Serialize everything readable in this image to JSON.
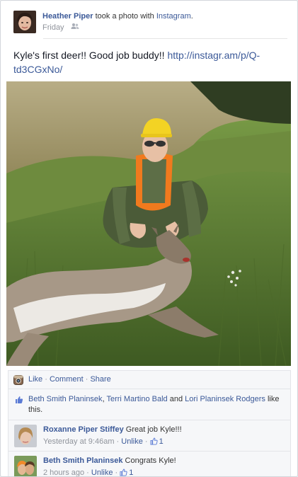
{
  "post": {
    "author": "Heather Piper",
    "action_prefix": "took a photo with",
    "app": "Instagram",
    "action_suffix": ".",
    "time": "Friday",
    "caption_text": "Kyle's first deer!! Good job buddy!!",
    "caption_url": "http://instagr.am/p/Q-td3CGxNo/"
  },
  "actions": {
    "like": "Like",
    "sep1": " · ",
    "comment": "Comment",
    "sep2": " · ",
    "share": "Share"
  },
  "likes": {
    "name1": "Beth Smith Planinsek",
    "sep1": ", ",
    "name2": "Terri Martino Bald",
    "sep2": " and ",
    "name3": "Lori Planinsek Rodgers",
    "suffix": " like this."
  },
  "comments": [
    {
      "author": "Roxanne Piper Stiffey",
      "text": "Great job Kyle!!!",
      "time": "Yesterday at 9:46am",
      "sep1": " · ",
      "unlike": "Unlike",
      "sep2": " · ",
      "likes": "1"
    },
    {
      "author": "Beth Smith Planinsek",
      "text": "Congrats Kyle!",
      "time": "2 hours ago",
      "sep1": " · ",
      "unlike": "Unlike",
      "sep2": " · ",
      "likes": "1"
    }
  ],
  "icons": {
    "friends": "friends-icon",
    "instagram": "instagram-icon",
    "like_thumb": "like-thumb-icon"
  },
  "colors": {
    "link": "#3b5998",
    "meta": "#90949c",
    "ufi_bg": "#f6f7f9"
  }
}
